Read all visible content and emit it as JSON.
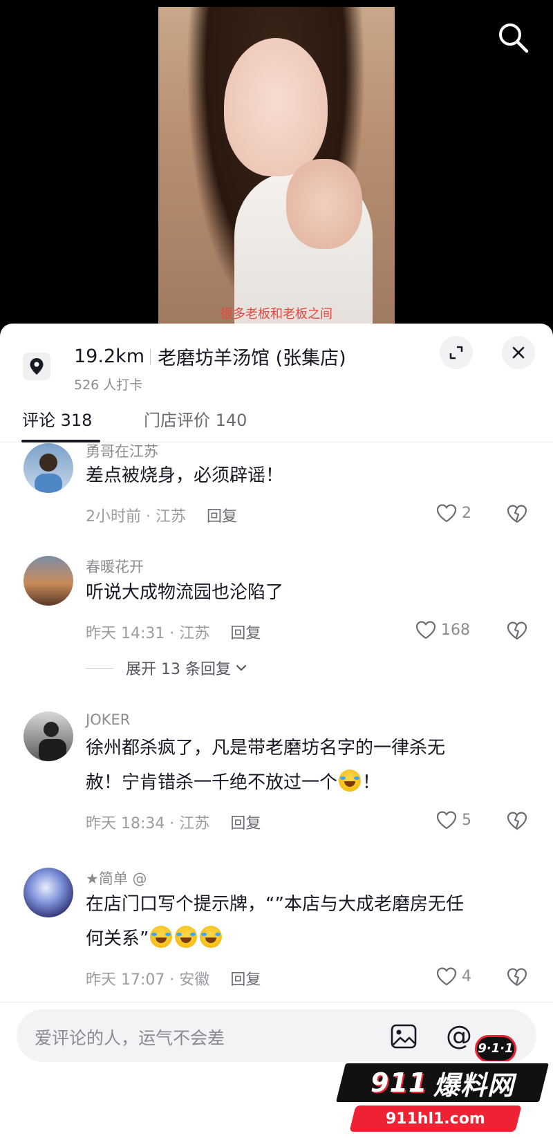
{
  "video": {
    "subtitle": "很多老板和老板之间"
  },
  "shop": {
    "distance": "19.2km",
    "name": "老磨坊羊汤馆 (张集店)",
    "checkins": "526 人打卡"
  },
  "tabs": [
    {
      "label": "评论 318"
    },
    {
      "label": "门店评价 140"
    }
  ],
  "comments": [
    {
      "user": "勇哥在江苏",
      "text": "差点被烧身，必须辟谣！",
      "time_loc": "2小时前 · 江苏",
      "reply": "回复",
      "likes": "2"
    },
    {
      "user": "春暖花开",
      "text": "听说大成物流园也沦陷了",
      "time_loc": "昨天 14:31 · 江苏",
      "reply": "回复",
      "likes": "168",
      "expand": "展开 13 条回复"
    },
    {
      "user": "JOKER",
      "text_line1": "徐州都杀疯了，凡是带老磨坊名字的一律杀无",
      "text_line2a": "赦！宁肯错杀一千绝不放过一个",
      "text_line2b": "！",
      "time_loc": "昨天 18:34 · 江苏",
      "reply": "回复",
      "likes": "5"
    },
    {
      "user": "★简单 @",
      "text_line1": "在店门口写个提示牌，“”本店与大成老磨房无任",
      "text_line2": "何关系”",
      "time_loc": "昨天 17:07 · 安徽",
      "reply": "回复",
      "likes": "4"
    }
  ],
  "input": {
    "placeholder": "爱评论的人，运气不会差",
    "at_symbol": "@"
  },
  "watermark": {
    "badge": "9·1·1",
    "brand_num": "911",
    "brand_text": "爆料网",
    "url": "911hl1.com"
  },
  "colors": {
    "accent_red": "#e8453c",
    "text_primary": "#161823",
    "text_secondary": "#8a8b91"
  }
}
